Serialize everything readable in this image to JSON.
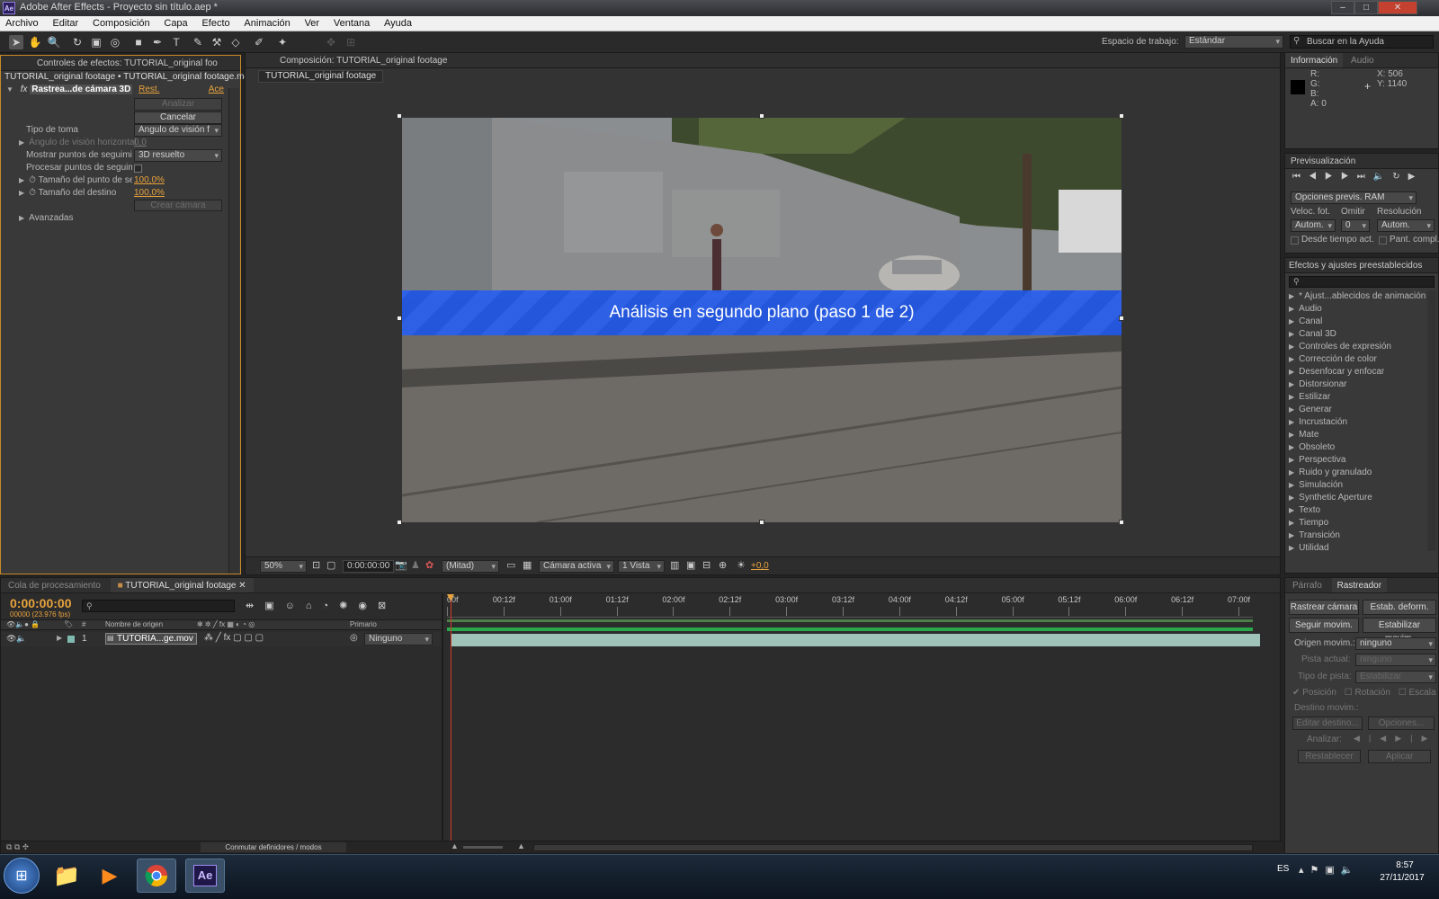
{
  "app": {
    "title": "Adobe After Effects - Proyecto sin título.aep *",
    "logo_text": "Ae"
  },
  "window_controls": [
    "–",
    "□",
    "✕"
  ],
  "menu": [
    "Archivo",
    "Editar",
    "Composición",
    "Capa",
    "Efecto",
    "Animación",
    "Ver",
    "Ventana",
    "Ayuda"
  ],
  "workspace": {
    "label": "Espacio de trabajo:",
    "value": "Estándar",
    "help_placeholder": "Buscar en la Ayuda"
  },
  "effects_panel": {
    "tab": "Controles de efectos: TUTORIAL_original foo",
    "path": "TUTORIAL_original footage • TUTORIAL_original footage.mo",
    "effect_name": "Rastrea...de cámara 3D",
    "reset": "Rest.",
    "about": "Ace",
    "analyze_btn": "Analizar",
    "cancel_btn": "Cancelar",
    "rows": [
      {
        "label": "Tipo de toma",
        "value": "Ángulo de visión f"
      },
      {
        "label": "Ángulo de visión horizontal",
        "value": "0,0"
      },
      {
        "label": "Mostrar puntos de seguimi",
        "value": "3D resuelto"
      },
      {
        "label": "Procesar puntos de seguim",
        "value": ""
      },
      {
        "label": "Tamaño del punto de se",
        "value": "100,0%"
      },
      {
        "label": "Tamaño del destino",
        "value": "100,0%"
      }
    ],
    "create_camera_btn": "Crear cámara",
    "advanced": "Avanzadas"
  },
  "composition": {
    "tab": "Composición: TUTORIAL_original footage",
    "sub_tab": "TUTORIAL_original footage",
    "banner": "Análisis en segundo plano (paso 1 de 2)",
    "footer": {
      "zoom": "50%",
      "timecode": "0:00:00:00",
      "resolution": "(Mitad)",
      "camera": "Cámara activa",
      "views": "1 Vista",
      "exposure": "+0,0"
    }
  },
  "info_panel": {
    "tabs": [
      "Información",
      "Audio"
    ],
    "channels": [
      "R:",
      "G:",
      "B:",
      "A:  0"
    ],
    "x": "X: 506",
    "y": "Y: 1140"
  },
  "preview_panel": {
    "tab": "Previsualización",
    "ram_options": "Opciones previs. RAM",
    "labels": [
      "Veloc. fot.",
      "Omitir",
      "Resolución"
    ],
    "fps": "Autom.",
    "skip": "0",
    "resolution": "Autom.",
    "from_current": "Desde tiempo act.",
    "full_screen": "Pant. compl."
  },
  "effects_presets": {
    "tab": "Efectos y ajustes preestablecidos",
    "items": [
      "* Ajust...ablecidos de animación",
      "Audio",
      "Canal",
      "Canal 3D",
      "Controles de expresión",
      "Corrección de color",
      "Desenfocar y enfocar",
      "Distorsionar",
      "Estilizar",
      "Generar",
      "Incrustación",
      "Mate",
      "Obsoleto",
      "Perspectiva",
      "Ruido y granulado",
      "Simulación",
      "Synthetic Aperture",
      "Texto",
      "Tiempo",
      "Transición",
      "Utilidad"
    ]
  },
  "timeline": {
    "tabs": [
      "Cola de procesamiento",
      "TUTORIAL_original footage"
    ],
    "timecode": "0:00:00:00",
    "frames": "00000 (23.976 fps)",
    "col_headers": {
      "num": "#",
      "name": "Nombre de origen",
      "parent": "Primario"
    },
    "layer": {
      "index": "1",
      "name": "TUTORIA...ge.mov",
      "parent": "Ninguno"
    },
    "ruler": [
      "00f",
      "00:12f",
      "01:00f",
      "01:12f",
      "02:00f",
      "02:12f",
      "03:00f",
      "03:12f",
      "04:00f",
      "04:12f",
      "05:00f",
      "05:12f",
      "06:00f",
      "06:12f",
      "07:00f"
    ],
    "toggle_label": "Conmutar definidores / modos"
  },
  "tracker_panel": {
    "tabs": [
      "Párrafo",
      "Rastreador"
    ],
    "buttons": [
      "Rastrear cámara",
      "Estab. deform.",
      "Seguir movim.",
      "Estabilizar movim."
    ],
    "motion_source_label": "Origen movim.:",
    "motion_source": "ninguno",
    "current_track_label": "Pista actual:",
    "current_track": "ninguno",
    "track_type_label": "Tipo de pista:",
    "track_type": "Estabilizar",
    "checks": [
      "Posición",
      "Rotación",
      "Escala"
    ],
    "target_label": "Destino movim.:",
    "edit_target": "Editar destino...",
    "options": "Opciones...",
    "analyze_label": "Analizar:",
    "reset": "Restablecer",
    "apply": "Aplicar"
  },
  "taskbar": {
    "lang": "ES",
    "time": "8:57",
    "date": "27/11/2017"
  }
}
